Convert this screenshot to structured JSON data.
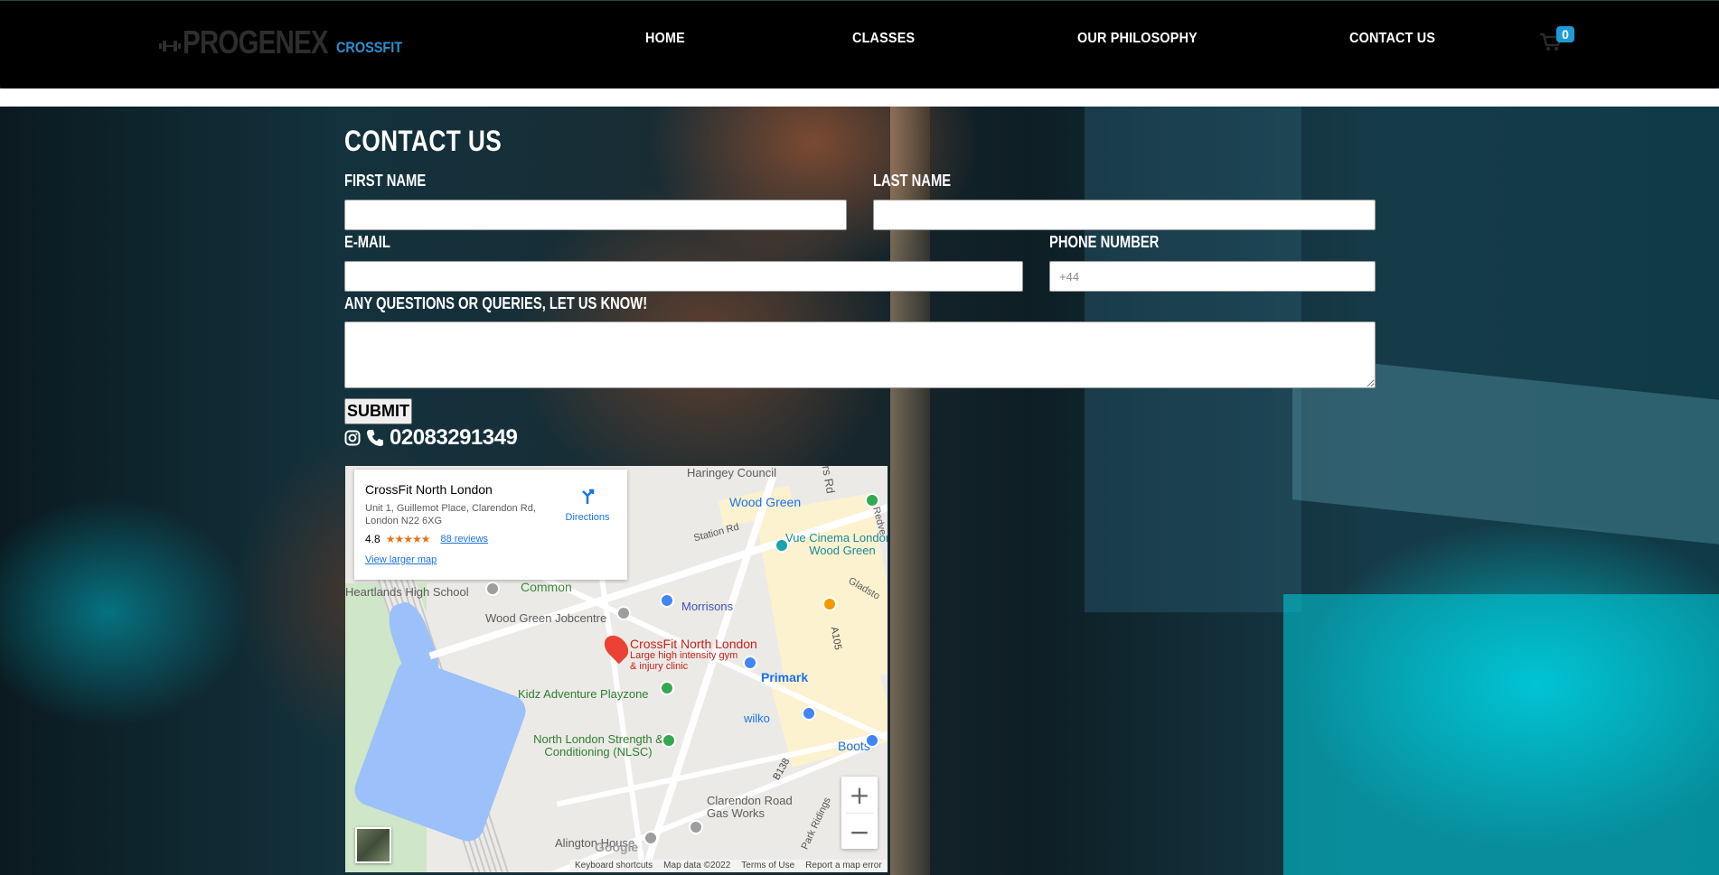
{
  "header": {
    "logo_main": "PROGENEX",
    "logo_sub": "CROSSFIT",
    "nav": [
      {
        "label": "HOME"
      },
      {
        "label": "CLASSES"
      },
      {
        "label": "OUR PHILOSOPHY"
      },
      {
        "label": "CONTACT US"
      }
    ],
    "cart_count": "0",
    "colors": {
      "bar": "#000000",
      "accent": "#1d9bd6"
    }
  },
  "form": {
    "title": "CONTACT US",
    "first_name_label": "FIRST NAME",
    "last_name_label": "LAST NAME",
    "email_label": "E-MAIL",
    "phone_label": "PHONE NUMBER",
    "phone_placeholder": "+44",
    "questions_label": "ANY QUESTIONS OR QUERIES, LET US KNOW!",
    "submit_label": "SUBMIT"
  },
  "contact": {
    "phone": "02083291349",
    "icons": [
      "instagram-icon",
      "phone-icon"
    ]
  },
  "map": {
    "place_name": "CrossFit North London",
    "address": "Unit 1, Guillemot Place, Clarendon Rd, London N22 6XG",
    "rating": "4.8",
    "stars": "★★★★★",
    "reviews": "88 reviews",
    "view_larger": "View larger map",
    "directions": "Directions",
    "labels": {
      "haringey_council": "Haringey Council",
      "wood_green": "Wood Green",
      "station_rd": "Station Rd",
      "vue_cinema": "Vue Cinema London - Wood Green",
      "heartlands": "Heartlands High School",
      "common": "Common",
      "morrisons": "Morrisons",
      "jobcentre": "Wood Green Jobcentre",
      "pin_name": "CrossFit North London",
      "pin_desc": "Large high intensity gym & injury clinic",
      "kidz": "Kidz Adventure Playzone",
      "primark": "Primark",
      "wilko": "wilko",
      "boots": "Boots",
      "nlsc": "North London Strength & Conditioning (NLSC)",
      "a105": "A105",
      "b138": "B138",
      "clarendon": "Clarendon Road Gas Works",
      "alington": "Alington House",
      "park_ridings": "Park Ridings",
      "gladstone": "Gladsto",
      "redvers": "Redve",
      "ers_rd": "ers Rd"
    },
    "google": "Google",
    "attribution": [
      "Keyboard shortcuts",
      "Map data ©2022",
      "Terms of Use",
      "Report a map error"
    ]
  }
}
